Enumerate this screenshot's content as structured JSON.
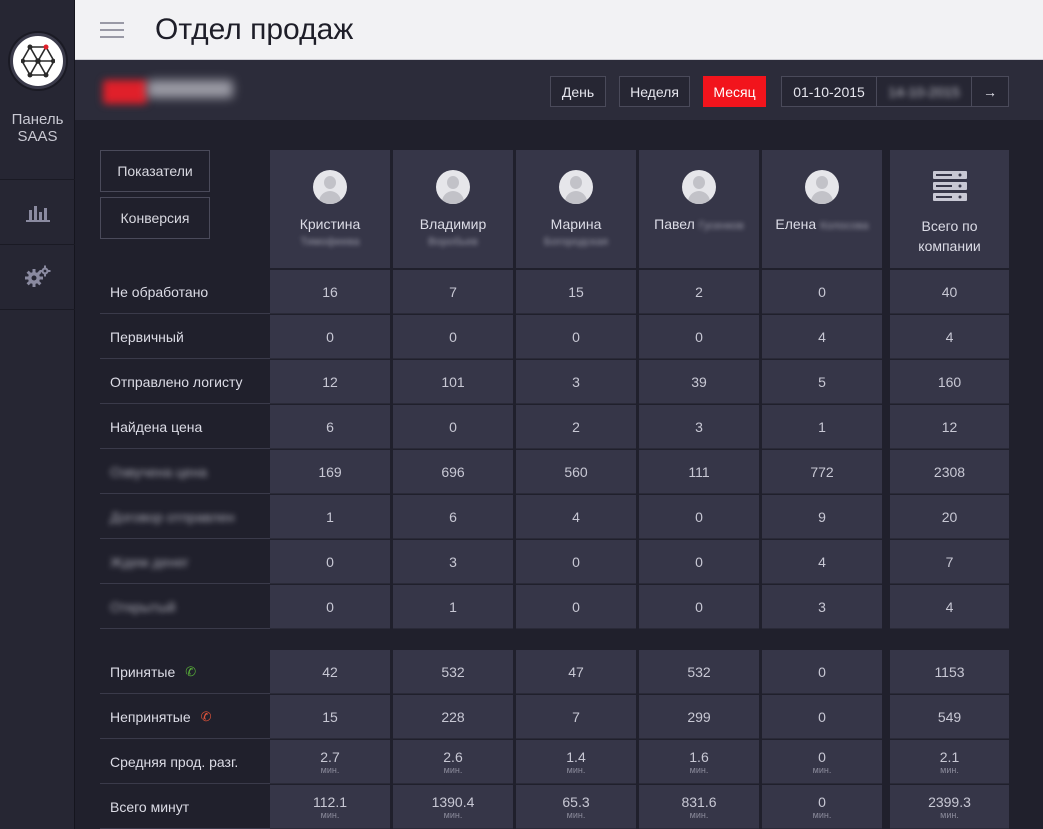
{
  "sidebar": {
    "brand": "Панель SAAS",
    "items": [
      {
        "icon": "bar-chart-icon"
      },
      {
        "icon": "gears-icon"
      }
    ]
  },
  "header": {
    "title": "Отдел продаж"
  },
  "toolbar": {
    "company_name": "Magazzino",
    "periods": [
      {
        "label": "День",
        "active": false
      },
      {
        "label": "Неделя",
        "active": false
      },
      {
        "label": "Месяц",
        "active": true
      }
    ],
    "date_from": "01-10-2015",
    "date_to": "14-10-2015",
    "go_symbol": "→"
  },
  "tabs": {
    "indicators": "Показатели",
    "conversion": "Конверсия"
  },
  "employees": [
    {
      "first": "Кристина",
      "last": "Тимофеева"
    },
    {
      "first": "Владимир",
      "last": "Воробьев"
    },
    {
      "first": "Марина",
      "last": "Богородская"
    },
    {
      "first": "Павел",
      "last": "Гусенков"
    },
    {
      "first": "Елена",
      "last": "Колосова"
    }
  ],
  "total_column": {
    "title_line1": "Всего по",
    "title_line2": "компании"
  },
  "status_rows": [
    {
      "label": "Не обработано",
      "values": [
        "16",
        "7",
        "15",
        "2",
        "0",
        "40"
      ]
    },
    {
      "label": "Первичный",
      "values": [
        "0",
        "0",
        "0",
        "0",
        "4",
        "4"
      ]
    },
    {
      "label": "Отправлено логисту",
      "values": [
        "12",
        "101",
        "3",
        "39",
        "5",
        "160"
      ]
    },
    {
      "label": "Найдена цена",
      "values": [
        "6",
        "0",
        "2",
        "3",
        "1",
        "12"
      ]
    },
    {
      "label": "Озвучена цена",
      "values": [
        "169",
        "696",
        "560",
        "111",
        "772",
        "2308"
      ]
    },
    {
      "label": "Договор отправлен",
      "values": [
        "1",
        "6",
        "4",
        "0",
        "9",
        "20"
      ]
    },
    {
      "label": "Ждем денег",
      "values": [
        "0",
        "3",
        "0",
        "0",
        "4",
        "7"
      ]
    },
    {
      "label": "Открытый",
      "values": [
        "0",
        "1",
        "0",
        "0",
        "3",
        "4"
      ]
    }
  ],
  "call_rows": [
    {
      "label": "Принятые",
      "values": [
        "42",
        "532",
        "47",
        "532",
        "0",
        "1153"
      ]
    },
    {
      "label": "Непринятые",
      "values": [
        "15",
        "228",
        "7",
        "299",
        "0",
        "549"
      ]
    },
    {
      "label": "Средняя прод. разг.",
      "values": [
        "2.7",
        "2.6",
        "1.4",
        "1.6",
        "0",
        "2.1"
      ],
      "unit": "мин."
    },
    {
      "label": "Всего минут",
      "values": [
        "112.1",
        "1390.4",
        "65.3",
        "831.6",
        "0",
        "2399.3"
      ],
      "unit": "мин."
    }
  ],
  "colors": {
    "accent": "#f2141c",
    "accepted": "#5ab23a",
    "missed": "#e0533a"
  }
}
